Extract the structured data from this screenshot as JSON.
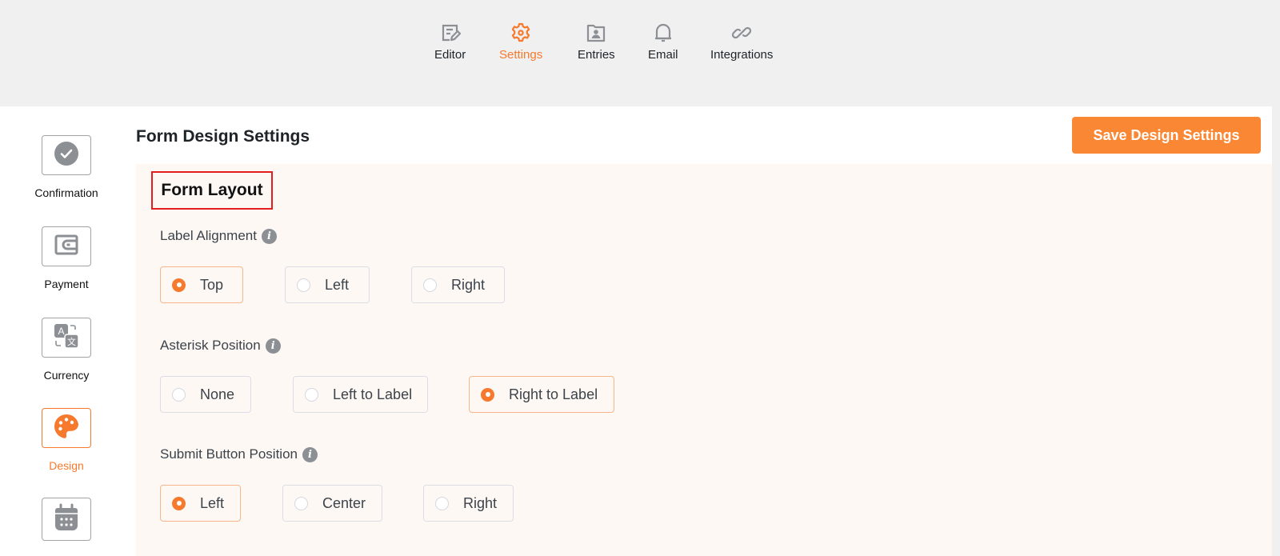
{
  "topnav": {
    "items": [
      {
        "label": "Editor",
        "icon": "editor-icon",
        "active": false
      },
      {
        "label": "Settings",
        "icon": "gear-icon",
        "active": true
      },
      {
        "label": "Entries",
        "icon": "entries-icon",
        "active": false
      },
      {
        "label": "Email",
        "icon": "bell-icon",
        "active": false
      },
      {
        "label": "Integrations",
        "icon": "link-icon",
        "active": false
      }
    ]
  },
  "sidebar": {
    "items": [
      {
        "label": "Confirmation",
        "icon": "check-circle-icon",
        "active": false
      },
      {
        "label": "Payment",
        "icon": "wallet-icon",
        "active": false
      },
      {
        "label": "Currency",
        "icon": "translate-icon",
        "active": false
      },
      {
        "label": "Design",
        "icon": "palette-icon",
        "active": true
      },
      {
        "label": "",
        "icon": "calendar-icon",
        "active": false
      }
    ]
  },
  "header": {
    "title": "Form Design Settings",
    "save_label": "Save Design Settings"
  },
  "section": {
    "title": "Form Layout"
  },
  "fields": [
    {
      "label": "Label Alignment",
      "options": [
        "Top",
        "Left",
        "Right"
      ],
      "selected": "Top"
    },
    {
      "label": "Asterisk Position",
      "options": [
        "None",
        "Left to Label",
        "Right to Label"
      ],
      "selected": "Right to Label"
    },
    {
      "label": "Submit Button Position",
      "options": [
        "Left",
        "Center",
        "Right"
      ],
      "selected": "Left"
    }
  ],
  "colors": {
    "accent": "#f7792d",
    "save_button": "#f98734",
    "content_bg": "#fdf8f4",
    "highlight_border": "#e41e1e"
  }
}
